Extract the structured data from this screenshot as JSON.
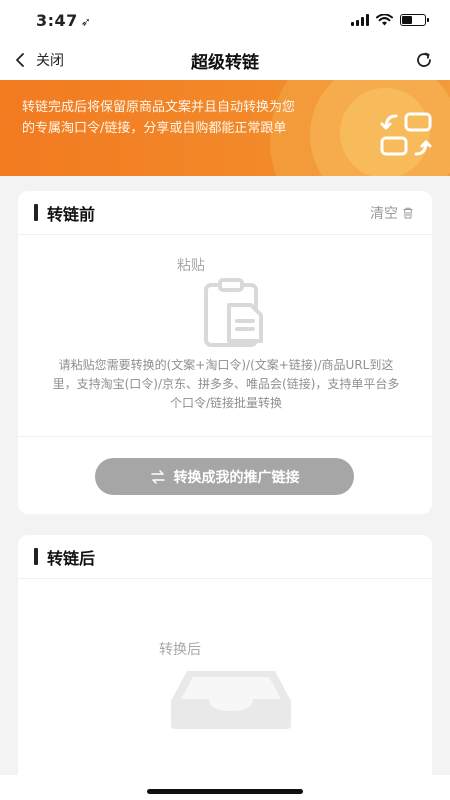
{
  "status_bar": {
    "time": "3:47",
    "location_glyph": "➶",
    "icons": [
      "cellular-signal-icon",
      "wifi-icon",
      "battery-icon"
    ],
    "battery_level": 0.45
  },
  "nav": {
    "back_label": "关闭",
    "title": "超级转链",
    "icons": [
      "chevron-left-icon",
      "refresh-icon"
    ]
  },
  "banner": {
    "text": "转链完成后将保留原商品文案并且自动转换为您的专属淘口令/链接，分享或自购都能正常跟单",
    "icon": "convert-link-icon",
    "colors": {
      "gradient_start": "#f27a20",
      "gradient_end": "#f5a23e"
    }
  },
  "before_card": {
    "title": "转链前",
    "clear_label": "清空",
    "paste_label": "粘贴",
    "paste_hint": "请粘贴您需要转换的(文案+淘口令)/(文案+链接)/商品URL到这里，支持淘宝(口令)/京东、拼多多、唯品会(链接)，支持单平台多个口令/链接批量转换",
    "convert_button_label": "转换成我的推广链接",
    "icons": [
      "trash-icon",
      "clipboard-icon",
      "swap-arrows-icon"
    ],
    "button_color": "#a6a6a6"
  },
  "after_card": {
    "title": "转链后",
    "result_label": "转换后",
    "icons": [
      "empty-tray-icon"
    ]
  }
}
